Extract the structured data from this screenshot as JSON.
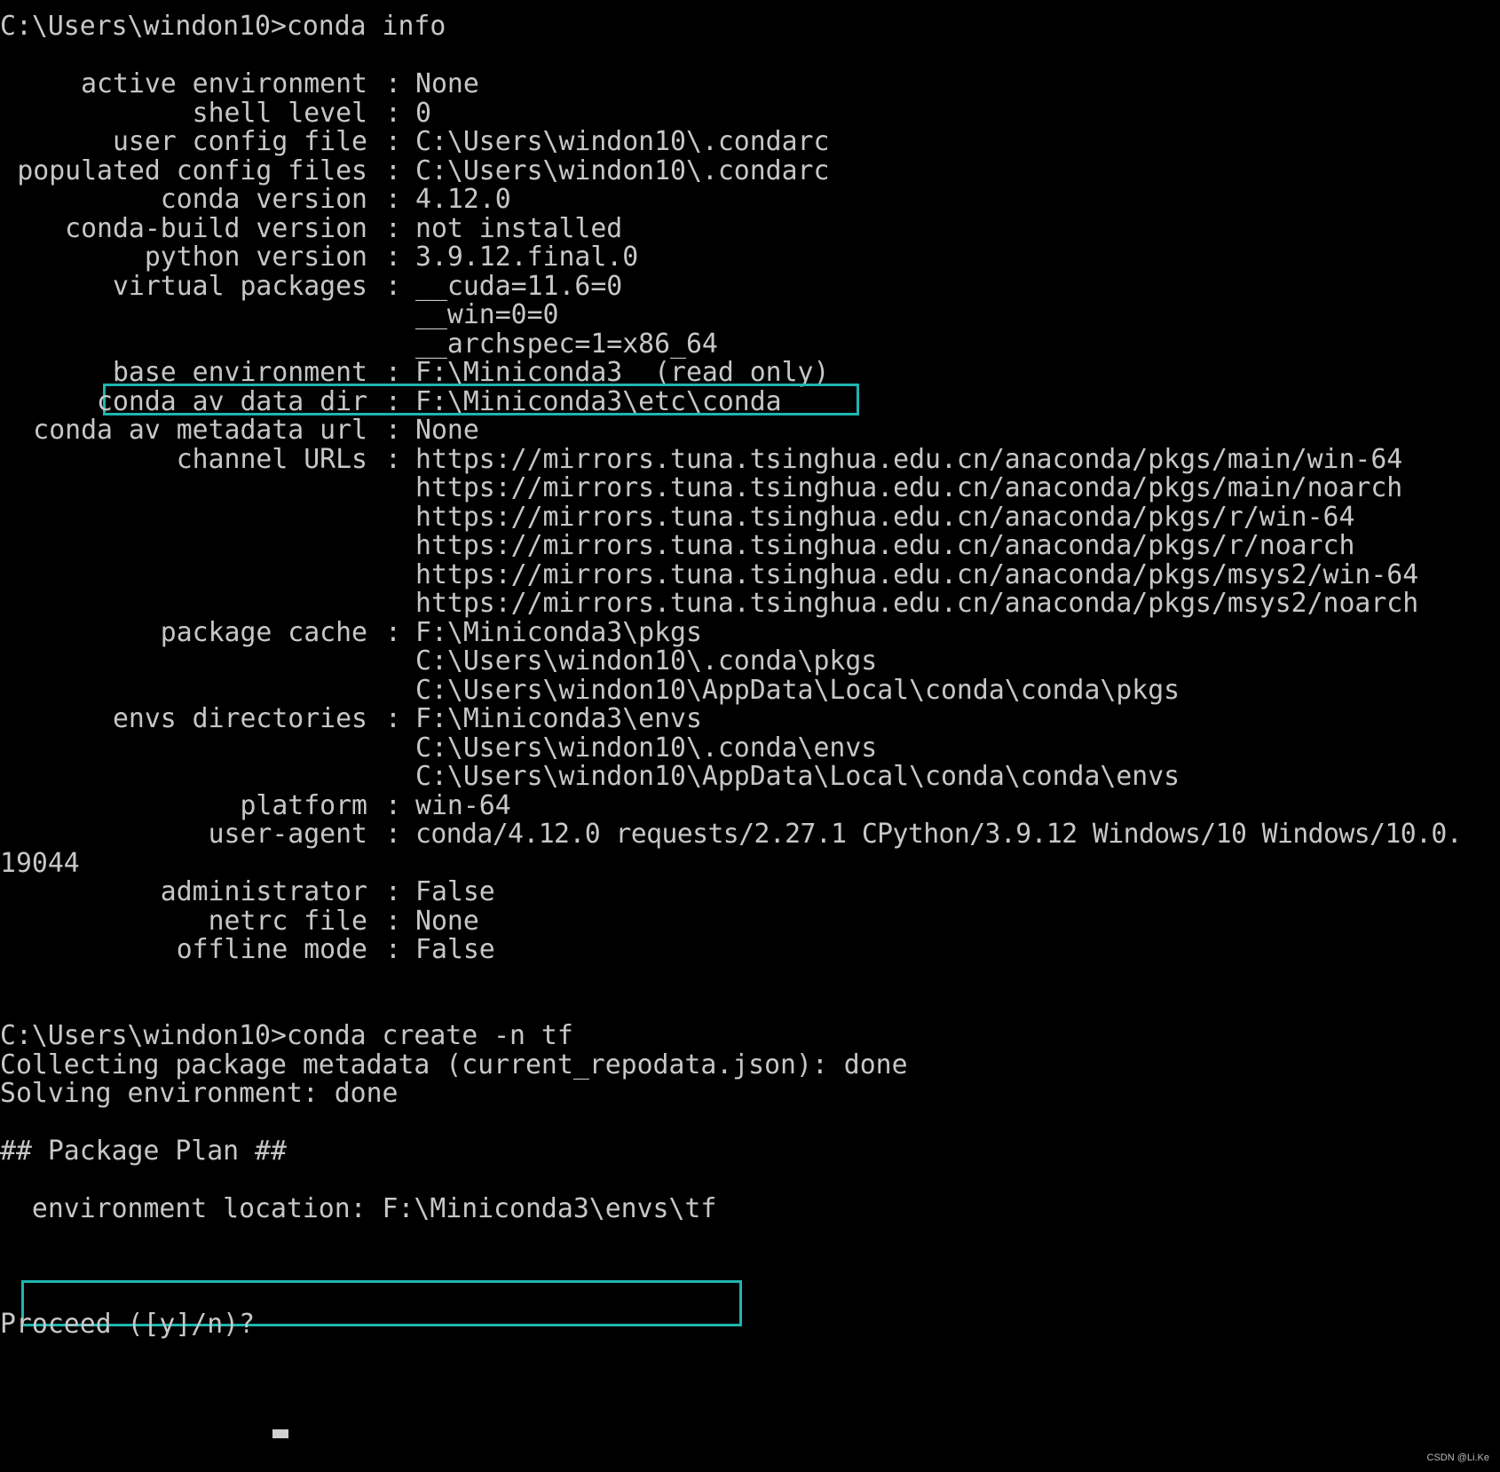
{
  "prompt1": "C:\\Users\\windon10>conda info",
  "info": [
    {
      "key": "active environment",
      "values": [
        "None"
      ]
    },
    {
      "key": "shell level",
      "values": [
        "0"
      ]
    },
    {
      "key": "user config file",
      "values": [
        "C:\\Users\\windon10\\.condarc"
      ]
    },
    {
      "key": "populated config files",
      "values": [
        "C:\\Users\\windon10\\.condarc"
      ]
    },
    {
      "key": "conda version",
      "values": [
        "4.12.0"
      ]
    },
    {
      "key": "conda-build version",
      "values": [
        "not installed"
      ]
    },
    {
      "key": "python version",
      "values": [
        "3.9.12.final.0"
      ]
    },
    {
      "key": "virtual packages",
      "values": [
        "__cuda=11.6=0",
        "__win=0=0",
        "__archspec=1=x86_64"
      ]
    },
    {
      "key": "base environment",
      "values": [
        "F:\\Miniconda3  (read only)"
      ]
    },
    {
      "key": "conda av data dir",
      "values": [
        "F:\\Miniconda3\\etc\\conda"
      ]
    },
    {
      "key": "conda av metadata url",
      "values": [
        "None"
      ]
    },
    {
      "key": "channel URLs",
      "values": [
        "https://mirrors.tuna.tsinghua.edu.cn/anaconda/pkgs/main/win-64",
        "https://mirrors.tuna.tsinghua.edu.cn/anaconda/pkgs/main/noarch",
        "https://mirrors.tuna.tsinghua.edu.cn/anaconda/pkgs/r/win-64",
        "https://mirrors.tuna.tsinghua.edu.cn/anaconda/pkgs/r/noarch",
        "https://mirrors.tuna.tsinghua.edu.cn/anaconda/pkgs/msys2/win-64",
        "https://mirrors.tuna.tsinghua.edu.cn/anaconda/pkgs/msys2/noarch"
      ]
    },
    {
      "key": "package cache",
      "values": [
        "F:\\Miniconda3\\pkgs",
        "C:\\Users\\windon10\\.conda\\pkgs",
        "C:\\Users\\windon10\\AppData\\Local\\conda\\conda\\pkgs"
      ]
    },
    {
      "key": "envs directories",
      "values": [
        "F:\\Miniconda3\\envs",
        "C:\\Users\\windon10\\.conda\\envs",
        "C:\\Users\\windon10\\AppData\\Local\\conda\\conda\\envs"
      ]
    },
    {
      "key": "platform",
      "values": [
        "win-64"
      ]
    },
    {
      "key": "user-agent",
      "values": [
        "conda/4.12.0 requests/2.27.1 CPython/3.9.12 Windows/10 Windows/10.0."
      ]
    },
    {
      "key": "administrator",
      "values": [
        "False"
      ]
    },
    {
      "key": "netrc file",
      "values": [
        "None"
      ]
    },
    {
      "key": "offline mode",
      "values": [
        "False"
      ]
    }
  ],
  "user_agent_wrap": "19044",
  "prompt2": "C:\\Users\\windon10>conda create -n tf",
  "collecting": "Collecting package metadata (current_repodata.json): done",
  "solving": "Solving environment: done",
  "plan_header": "## Package Plan ##",
  "env_location": "  environment location: F:\\Miniconda3\\envs\\tf",
  "proceed": "Proceed ([y]/n)? ",
  "watermark": "CSDN @Li.Ke",
  "colors": {
    "background": "#000000",
    "text": "#c7c7c7",
    "highlight": "#1fb5b0"
  }
}
